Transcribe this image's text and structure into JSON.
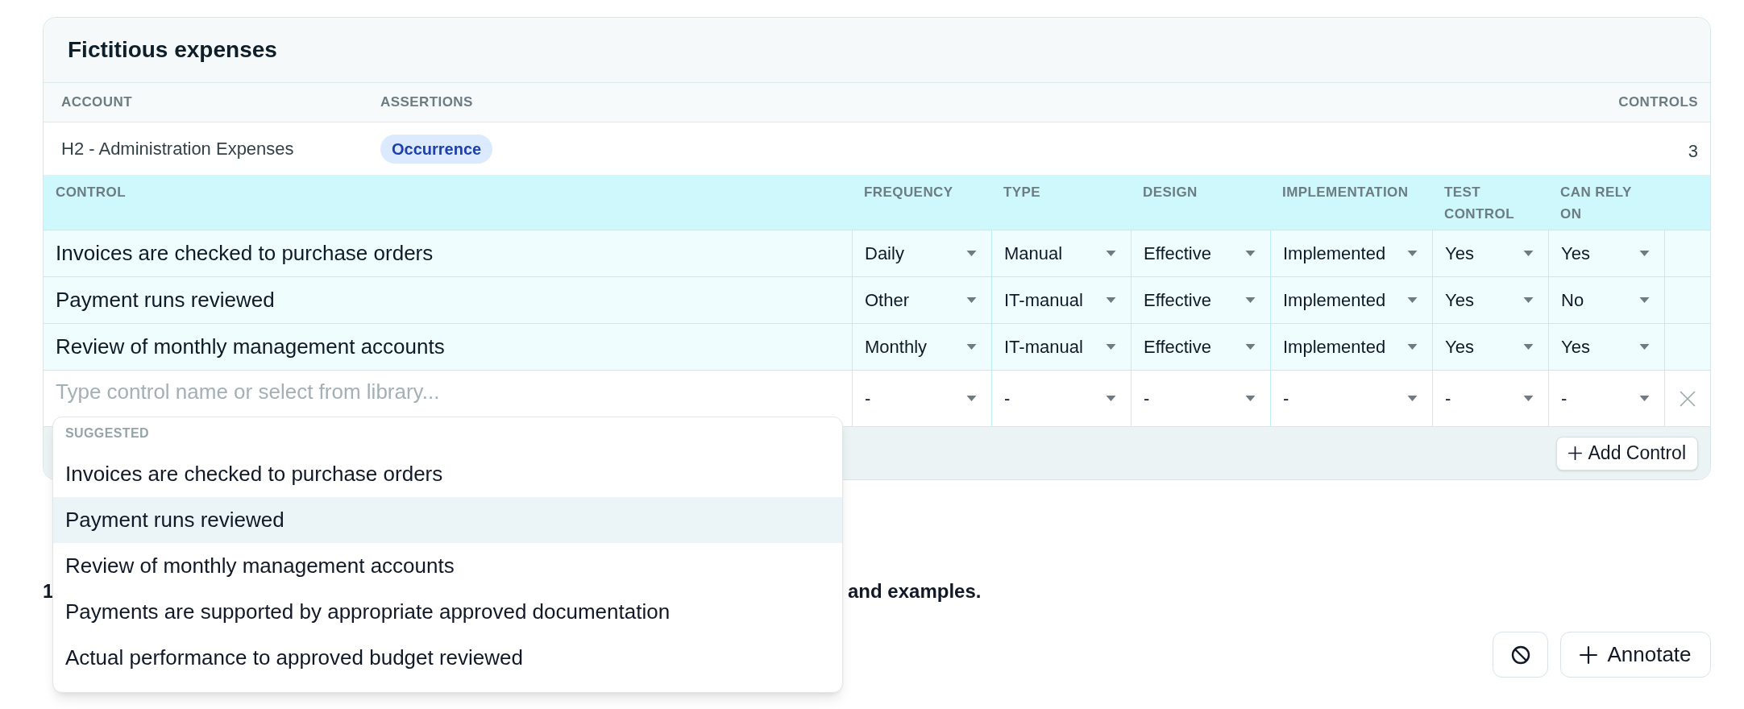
{
  "card": {
    "title": "Fictitious expenses",
    "account_columns": [
      "ACCOUNT",
      "ASSERTIONS",
      "CONTROLS"
    ],
    "accounts": [
      {
        "account": "H2 - Administration Expenses",
        "assertions": [
          "Occurrence"
        ],
        "controls": "3"
      }
    ],
    "control_columns": [
      "CONTROL",
      "FREQUENCY",
      "TYPE",
      "DESIGN",
      "IMPLEMENTATION",
      "TEST CONTROL",
      "CAN RELY ON"
    ],
    "controls": [
      {
        "name": "Invoices are checked to purchase orders",
        "values": [
          "Daily",
          "Manual",
          "Effective",
          "Implemented",
          "Yes",
          "Yes"
        ]
      },
      {
        "name": "Payment runs reviewed",
        "values": [
          "Other",
          "IT-manual",
          "Effective",
          "Implemented",
          "Yes",
          "No"
        ]
      },
      {
        "name": "Review of monthly management accounts",
        "values": [
          "Monthly",
          "IT-manual",
          "Effective",
          "Implemented",
          "Yes",
          "Yes"
        ]
      }
    ],
    "new_control": {
      "placeholder": "Type control name or select from library...",
      "values": [
        "-",
        "-",
        "-",
        "-",
        "-",
        "-"
      ]
    },
    "suggestions": {
      "heading": "SUGGESTED",
      "items": [
        {
          "label": "Invoices are checked to purchase orders",
          "selected": false
        },
        {
          "label": "Payment runs reviewed",
          "selected": true
        },
        {
          "label": "Review of monthly management accounts",
          "selected": false
        },
        {
          "label": "Payments are supported by appropriate approved documentation",
          "selected": false
        },
        {
          "label": "Actual performance to approved budget reviewed",
          "selected": false
        }
      ]
    },
    "add_button": "Add Control"
  },
  "notes": {
    "paragraph_start": "1",
    "paragraph_end": "and examples."
  },
  "actions": {
    "annotate_button": "Annotate"
  }
}
